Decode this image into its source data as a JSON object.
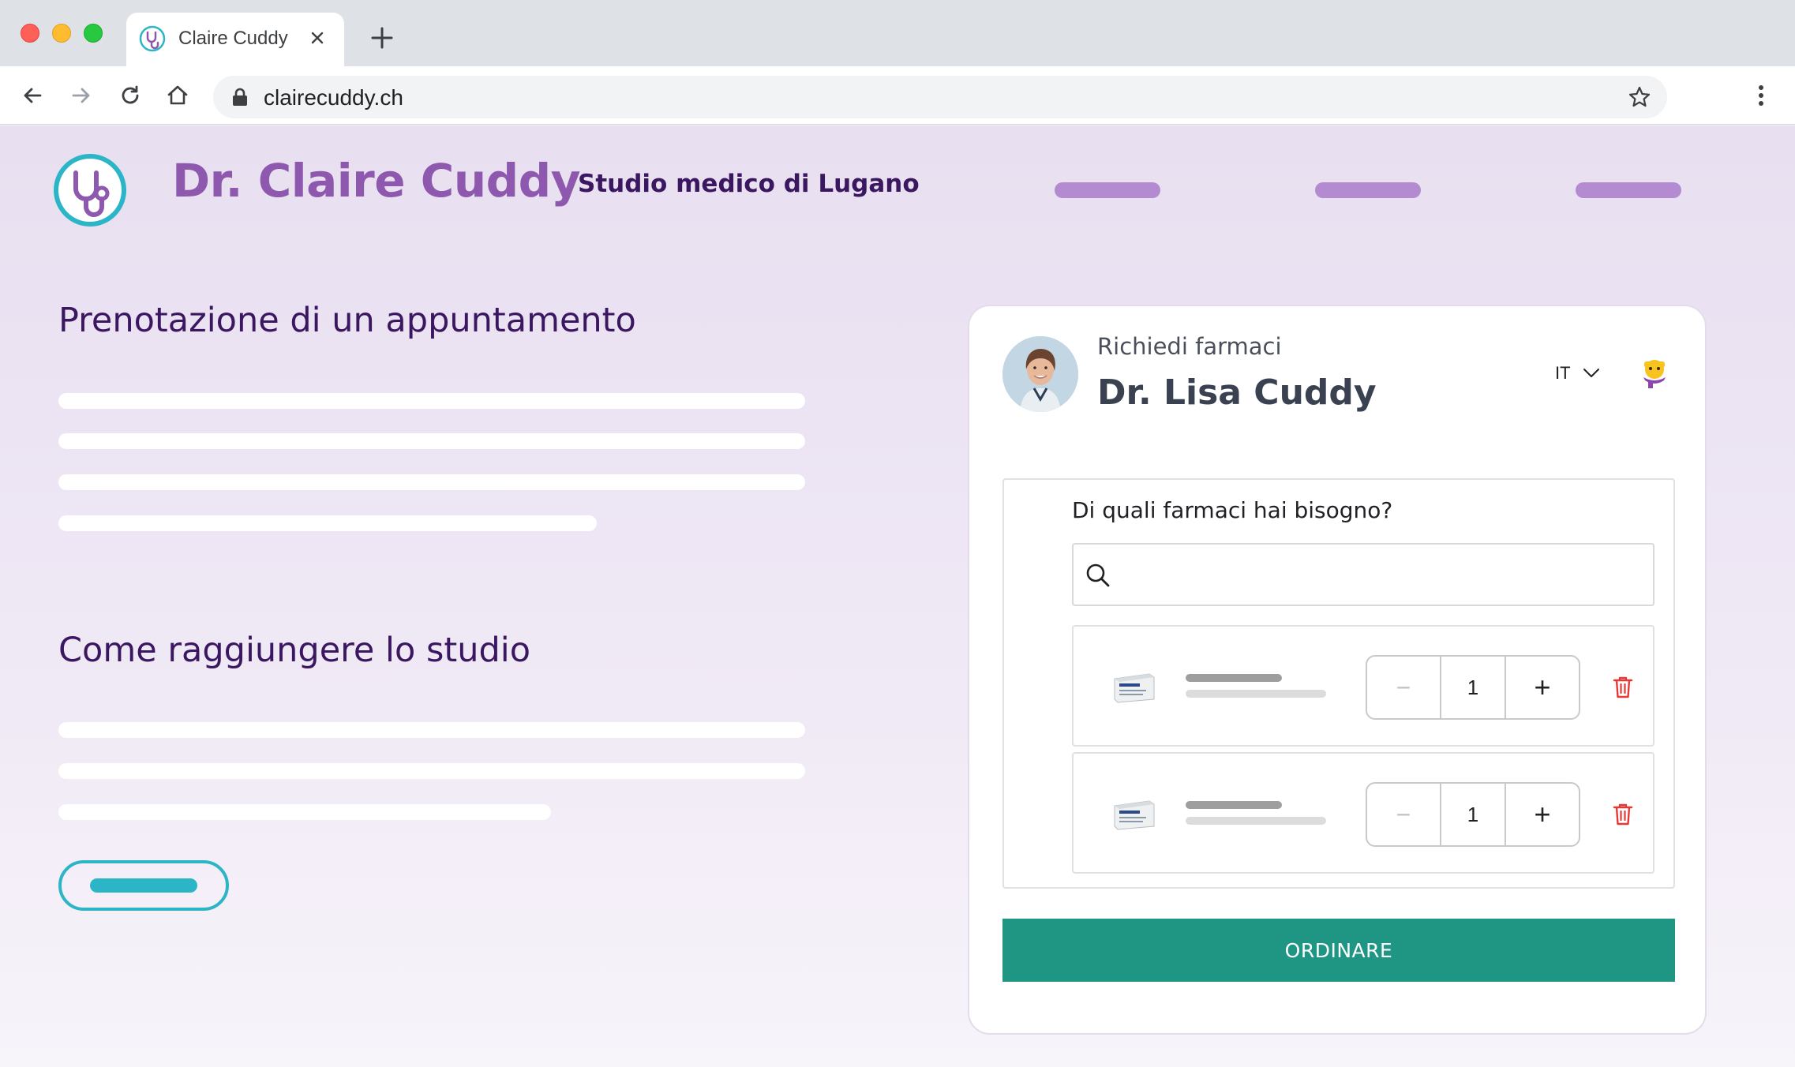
{
  "browser": {
    "tab_title": "Claire Cuddy",
    "url": "clairecuddy.ch"
  },
  "site": {
    "brand_name": "Dr. Claire Cuddy",
    "subtitle": "Studio medico di Lugano"
  },
  "sections": {
    "booking_title": "Prenotazione di un appuntamento",
    "directions_title": "Come raggiungere lo studio"
  },
  "widget": {
    "label": "Richiedi farmaci",
    "doctor_name": "Dr. Lisa Cuddy",
    "language": "IT",
    "question": "Di quali farmaci hai bisogno?",
    "search": {
      "value": "",
      "placeholder": ""
    },
    "items": [
      {
        "quantity": "1",
        "minus": "−",
        "plus": "+"
      },
      {
        "quantity": "1",
        "minus": "−",
        "plus": "+"
      }
    ],
    "order_label": "ORDINARE"
  },
  "colors": {
    "brand_purple": "#8d58ae",
    "heading_dark_purple": "#3a1760",
    "accent_teal": "#2bb5c6",
    "order_green": "#1f9584",
    "delete_red": "#e53935"
  },
  "icons": [
    "stethoscope-logo-icon",
    "lock-icon",
    "star-icon",
    "search-icon",
    "trash-icon",
    "chevron-down-icon",
    "mascot-icon"
  ]
}
